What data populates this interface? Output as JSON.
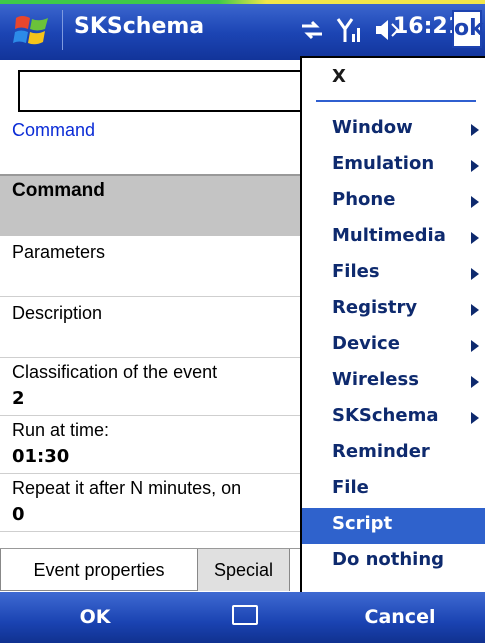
{
  "titlebar": {
    "app_title": "SKSchema",
    "clock": "16:21",
    "ok_label": "ok"
  },
  "command": {
    "input_value": "",
    "link_label": "Command"
  },
  "properties": {
    "header": "Command",
    "rows": [
      {
        "label": "Parameters",
        "value": ""
      },
      {
        "label": "Description",
        "value": ""
      },
      {
        "label": "Classification of the event",
        "value": "2"
      },
      {
        "label": "Run at time:",
        "value": "01:30"
      },
      {
        "label": "Repeat it after N minutes, on",
        "value": "0"
      }
    ]
  },
  "tabs": [
    {
      "label": "Event properties",
      "active": true
    },
    {
      "label": "Special",
      "active": false
    }
  ],
  "softkeys": {
    "left": "OK",
    "right": "Cancel"
  },
  "menu": {
    "close_label": "X",
    "items": [
      {
        "label": "Window",
        "submenu": true
      },
      {
        "label": "Emulation",
        "submenu": true
      },
      {
        "label": "Phone",
        "submenu": true
      },
      {
        "label": "Multimedia",
        "submenu": true
      },
      {
        "label": "Files",
        "submenu": true
      },
      {
        "label": "Registry",
        "submenu": true
      },
      {
        "label": "Device",
        "submenu": true
      },
      {
        "label": "Wireless",
        "submenu": true
      },
      {
        "label": "SKSchema",
        "submenu": true
      },
      {
        "label": "Reminder",
        "submenu": false
      },
      {
        "label": "File",
        "submenu": false
      },
      {
        "label": "Script",
        "submenu": false,
        "selected": true
      },
      {
        "label": "Do nothing",
        "submenu": false
      }
    ]
  },
  "colors": {
    "titlebar": "#1c45b4",
    "menu_highlight": "#2f62cc",
    "link": "#0a2bd6"
  }
}
